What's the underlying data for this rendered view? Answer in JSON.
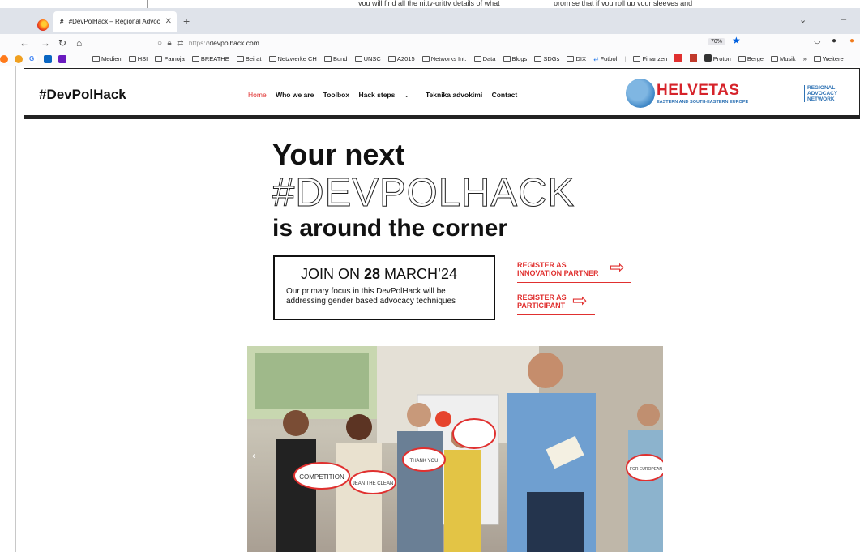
{
  "stray_text": {
    "left": "you will find all the nitty-gritty details of what",
    "right": "promise that if you roll up your sleeves and"
  },
  "browser": {
    "tab_title": "#DevPolHack – Regional Advoc",
    "tab_favicon": "#",
    "url_protocol": "https://",
    "url_host": "devpolhack.com",
    "zoom": "70%",
    "bookmarks": [
      "Medien",
      "HSI",
      "Pamoja",
      "BREATHE",
      "Beirat",
      "Netzwerke CH",
      "Bund",
      "UNSC",
      "A2015",
      "Networks Int.",
      "Data",
      "Blogs",
      "SDGs",
      "DIX",
      "Futbol",
      "Finanzen",
      "Proton",
      "Berge",
      "Musik",
      "Weitere"
    ],
    "overflow_label": "»"
  },
  "site": {
    "logo": "#DevPolHack",
    "nav": {
      "home": "Home",
      "who": "Who we are",
      "toolbox": "Toolbox",
      "hack_steps": "Hack steps",
      "teknika": "Teknika advokimi",
      "contact": "Contact"
    },
    "helvetas_name": "HELVETAS",
    "helvetas_sub": "EASTERN AND SOUTH-EASTERN EUROPE",
    "ran_line1": "REGIONAL",
    "ran_line2": "ADVOCACY",
    "ran_line3": "NETWORK"
  },
  "hero": {
    "line1": "Your next",
    "line2": "#DEVPOLHACK",
    "line3": "is around the corner"
  },
  "join": {
    "prefix": "JOIN ON ",
    "day": "28",
    "suffix": " MARCH’24",
    "description": "Our primary focus in this DevPolHack will be addressing gender based advocacy techniques"
  },
  "register": {
    "partner_line1": "REGISTER AS",
    "partner_line2": "INNOVATION PARTNER",
    "participant_line1": "REGISTER AS",
    "participant_line2": "PARTICIPANT"
  },
  "photo_signs": [
    "COMPETITION",
    "JEAN THE CLEAN",
    "THANK YOU",
    "FOR EUROPEAN"
  ],
  "colors": {
    "accent_red": "#e0302f",
    "helvetas_red": "#d6232a",
    "helvetas_blue": "#2e72b4",
    "tabbar_bg": "#dfe3ea"
  }
}
